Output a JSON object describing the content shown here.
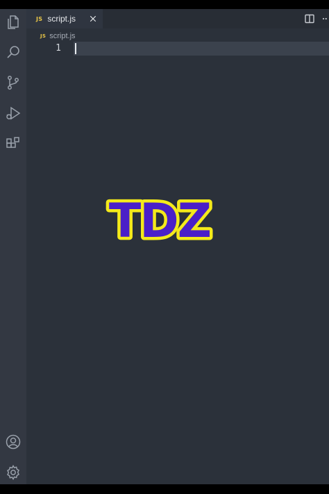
{
  "tab": {
    "badge": "JS",
    "filename": "script.js"
  },
  "breadcrumb": {
    "badge": "JS",
    "filename": "script.js"
  },
  "editor": {
    "line_numbers": [
      "1"
    ]
  },
  "logo": {
    "text": "TDZ",
    "fill": "#4a1fc8",
    "outline": "#f4ea1a"
  },
  "icons": {
    "activity": [
      "explorer-icon",
      "search-icon",
      "source-control-icon",
      "run-debug-icon",
      "extensions-icon"
    ],
    "bottom": [
      "account-icon",
      "settings-gear-icon"
    ],
    "tabbar": [
      "close-icon",
      "split-editor-icon",
      "more-actions-icon"
    ]
  },
  "colors": {
    "background": "#2b313a",
    "activity_bar": "#333842",
    "icon": "#9aa1ab",
    "js_badge": "#e7c547"
  }
}
